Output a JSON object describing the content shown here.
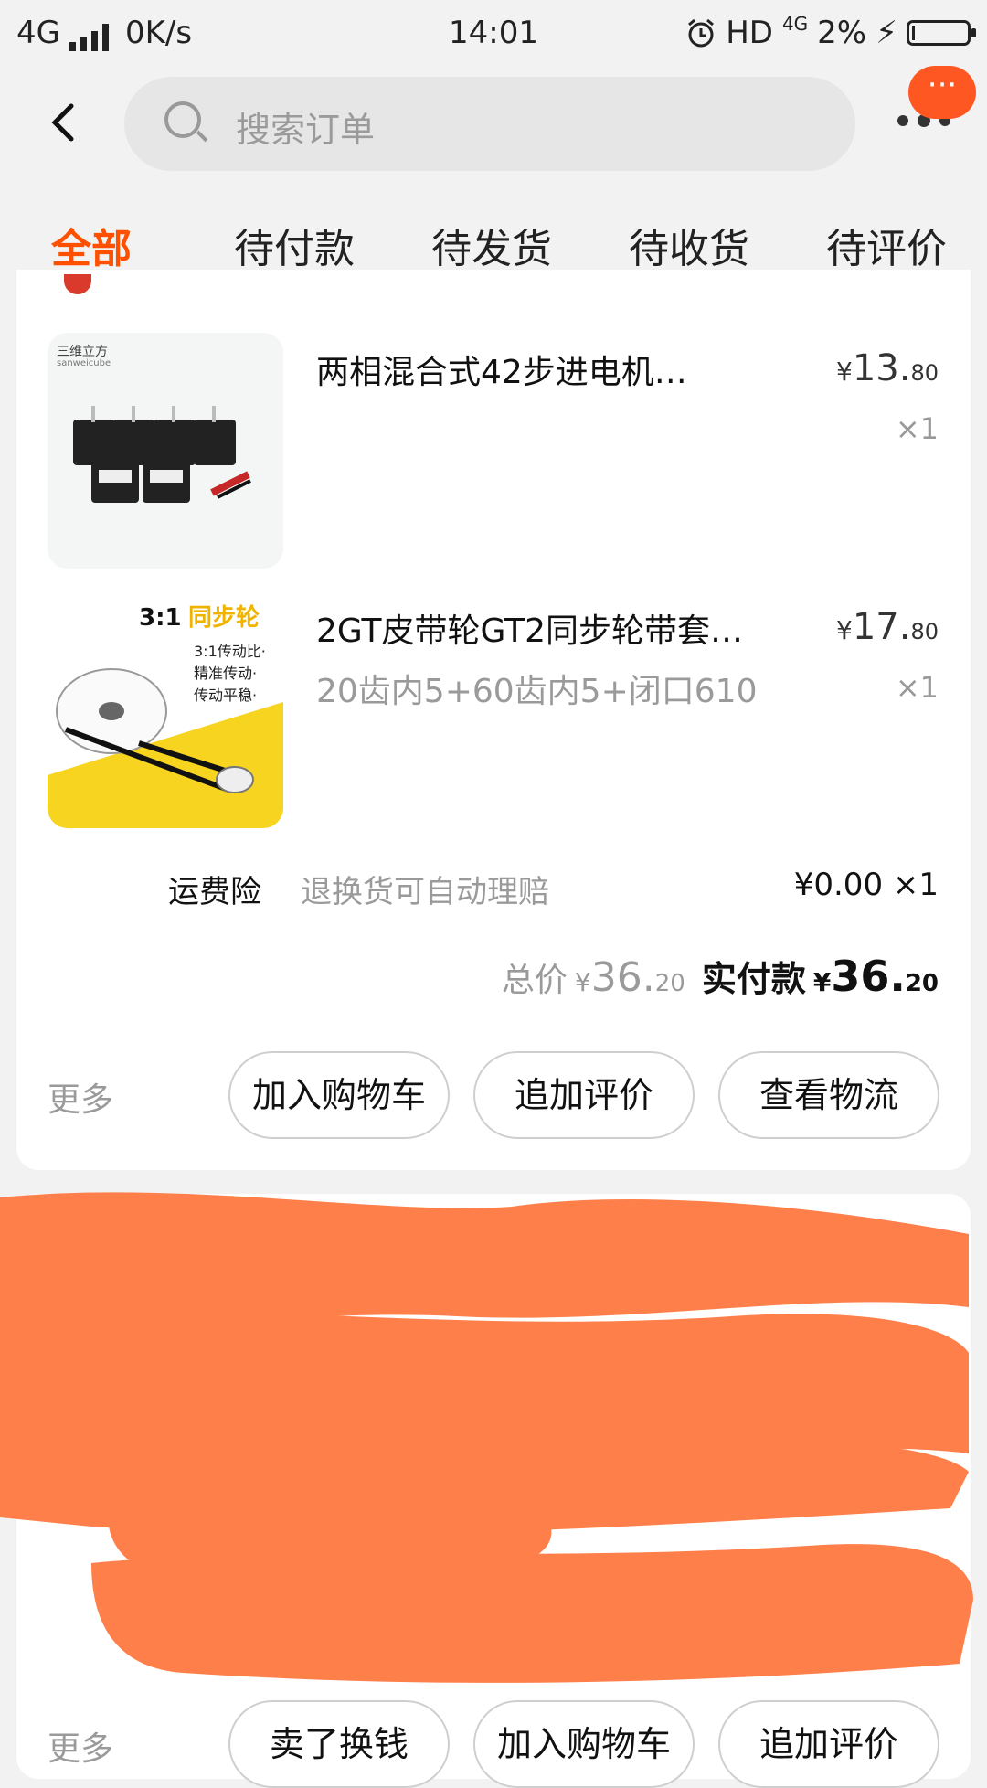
{
  "status_bar": {
    "network": "4G",
    "speed": "0K/s",
    "time": "14:01",
    "hd": "HD",
    "net2": "4G",
    "battery": "2%",
    "charging": "⚡"
  },
  "search": {
    "placeholder": "搜索订单"
  },
  "header": {
    "back_icon": "back-arrow-icon",
    "more_icon": "more-dots-icon",
    "badge": "···"
  },
  "tabs": [
    {
      "label": "全部",
      "active": true
    },
    {
      "label": "待付款"
    },
    {
      "label": "待发货"
    },
    {
      "label": "待收货"
    },
    {
      "label": "待评价"
    }
  ],
  "order1": {
    "items": [
      {
        "title": "两相混合式42步进电机…",
        "sku": "",
        "price_cur": "¥",
        "price_int": "13.",
        "price_dec": "80",
        "qty": "×1",
        "image_brand": "三维立方",
        "image_brand_sub": "sanweicube"
      },
      {
        "title": "2GT皮带轮GT2同步轮带套…",
        "sku": "20齿内5+60齿内5+闭口610",
        "price_cur": "¥",
        "price_int": "17.",
        "price_dec": "80",
        "qty": "×1",
        "image_ratio": "3:1",
        "image_heading": "同步轮",
        "image_lines": [
          "3:1传动比·",
          "精准传动·",
          "传动平稳·"
        ]
      }
    ],
    "insurance": {
      "label": "运费险",
      "desc": "退换货可自动理赔",
      "price": "¥0.00 ×1"
    },
    "total": {
      "label": "总价",
      "cur": "¥",
      "int": "36.",
      "dec": "20",
      "paid_label": "实付款",
      "paid_cur": "¥",
      "paid_int": "36.",
      "paid_dec": "20"
    },
    "more": "更多",
    "buttons": [
      "加入购物车",
      "追加评价",
      "查看物流"
    ]
  },
  "order2": {
    "more": "更多",
    "buttons": [
      "卖了换钱",
      "加入购物车",
      "追加评价"
    ]
  },
  "colors": {
    "accent": "#ff5000",
    "redaction": "#ff7f4a"
  }
}
